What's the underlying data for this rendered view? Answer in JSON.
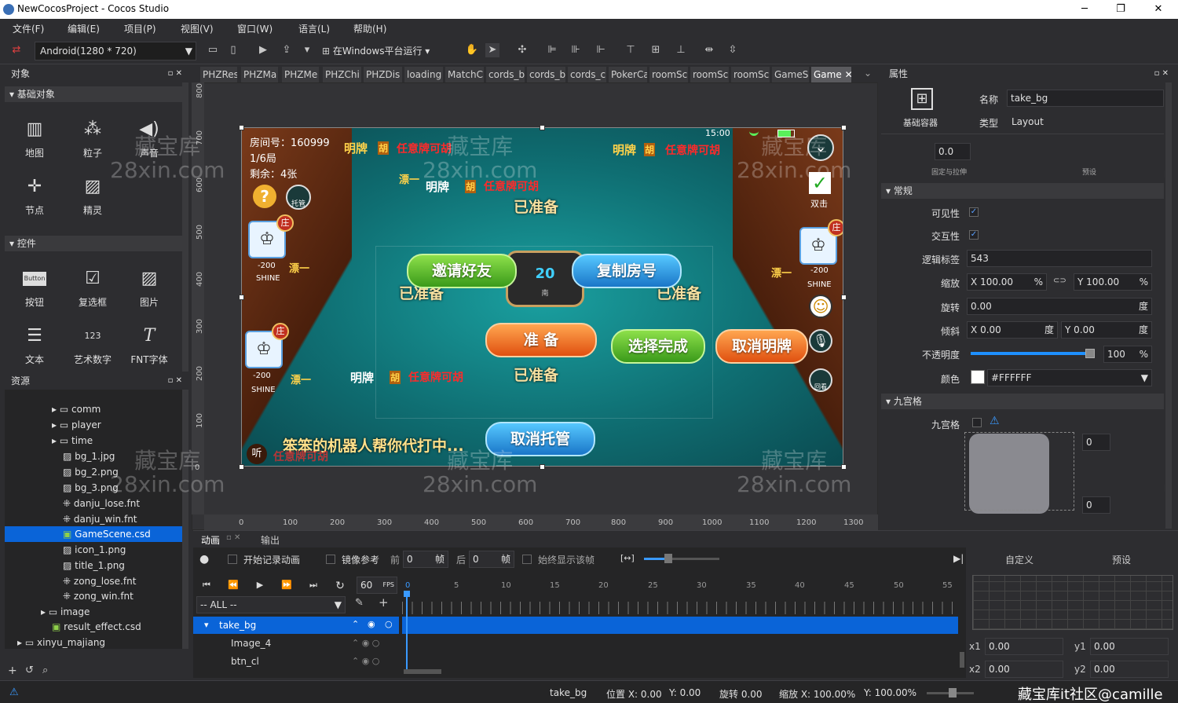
{
  "window": {
    "title": "NewCocosProject - Cocos Studio",
    "min": "─",
    "max": "❐",
    "close": "✕"
  },
  "menu": [
    "文件(F)",
    "编辑(E)",
    "项目(P)",
    "视图(V)",
    "窗口(W)",
    "语言(L)",
    "帮助(H)"
  ],
  "toolbar": {
    "resolution": "Android(1280 * 720)",
    "run_label": "在Windows平台运行"
  },
  "objects_panel": {
    "title": "对象",
    "basic_section": "基础对象",
    "basic_items": [
      "地图",
      "粒子",
      "声音",
      "节点",
      "精灵"
    ],
    "controls_section": "控件",
    "control_items": [
      "按钮",
      "复选框",
      "图片",
      "文本",
      "艺术数字",
      "FNT字体"
    ],
    "button_icon_text": "Button",
    "art_num_icon_text": "123"
  },
  "resources_panel": {
    "title": "资源",
    "items": [
      {
        "label": "comm",
        "type": "folder"
      },
      {
        "label": "player",
        "type": "folder"
      },
      {
        "label": "time",
        "type": "folder"
      },
      {
        "label": "bg_1.jpg",
        "type": "image"
      },
      {
        "label": "bg_2.png",
        "type": "image"
      },
      {
        "label": "bg_3.png",
        "type": "image"
      },
      {
        "label": "danju_lose.fnt",
        "type": "fnt"
      },
      {
        "label": "danju_win.fnt",
        "type": "fnt"
      },
      {
        "label": "GameScene.csd",
        "type": "csd",
        "selected": true
      },
      {
        "label": "icon_1.png",
        "type": "image"
      },
      {
        "label": "title_1.png",
        "type": "image"
      },
      {
        "label": "zong_lose.fnt",
        "type": "fnt"
      },
      {
        "label": "zong_win.fnt",
        "type": "fnt"
      },
      {
        "label": "image",
        "type": "folder"
      },
      {
        "label": "result_effect.csd",
        "type": "csd"
      },
      {
        "label": "xinyu_majiang",
        "type": "folder"
      }
    ]
  },
  "tabs": [
    "PHZRes",
    "PHZMa",
    "PHZMe",
    "PHZChi",
    "PHZDis",
    "loading",
    "MatchC",
    "cords_b",
    "cords_b",
    "cords_c",
    "PokerCa",
    "roomSc",
    "roomSc",
    "roomSc",
    "GameS",
    "Game"
  ],
  "ruler_y": [
    "800",
    "700",
    "600",
    "500",
    "400",
    "300",
    "200",
    "100",
    "0"
  ],
  "ruler_x": [
    "0",
    "100",
    "200",
    "300",
    "400",
    "500",
    "600",
    "700",
    "800",
    "900",
    "1000",
    "1100",
    "1200",
    "1300"
  ],
  "scene": {
    "room_no": "房间号：160999",
    "round": "1/6局",
    "remain": "剩余：4张",
    "time": "15:00",
    "tuoguan": "托管",
    "double": "双击",
    "ming": "明牌",
    "hu": "胡",
    "any_hu": "任意牌可胡",
    "piao": "漂一",
    "ready": "已准备",
    "score": "-200",
    "name": "SHINE",
    "zhuang": "庄",
    "invite": "邀请好友",
    "copy_room": "复制房号",
    "prepare": "准 备",
    "select_done": "选择完成",
    "cancel_ming": "取消明牌",
    "cancel_tuoguan": "取消托管",
    "bot_msg": "笨笨的机器人帮你代打中...",
    "listen": "听",
    "replay": "回看",
    "clock": "20",
    "clock_sub": "南",
    "wm1": "藏宝库",
    "wm2": "28xin.com"
  },
  "properties": {
    "title": "属性",
    "container": "基础容器",
    "name_label": "名称",
    "name_value": "take_bg",
    "type_label": "类型",
    "type_value": "Layout",
    "size_value": "0.0",
    "fixed_stretch": "固定与拉伸",
    "preset": "预设",
    "general": "常规",
    "visible": "可见性",
    "interactive": "交互性",
    "logic_tag": "逻辑标签",
    "logic_tag_value": "543",
    "scale": "缩放",
    "scale_x": "100.00",
    "scale_y": "100.00",
    "percent": "%",
    "rotation": "旋转",
    "rotation_value": "0.00",
    "degree": "度",
    "skew": "倾斜",
    "skew_x": "0.00",
    "skew_y": "0.00",
    "opacity": "不透明度",
    "opacity_value": "100",
    "color": "颜色",
    "color_value": "#FFFFFF",
    "nine": "九宫格",
    "nine_label": "九宫格",
    "nine_value": "0",
    "x": "X",
    "y": "Y"
  },
  "animation": {
    "tab1": "动画",
    "tab2": "输出",
    "record": "开始记录动画",
    "mirror": "镜像参考",
    "before": "前",
    "before_val": "0",
    "frame": "帧",
    "after": "后",
    "after_val": "0",
    "always_show": "始终显示该帧",
    "fps": "60",
    "fps_unit": "FPS",
    "all": "-- ALL --",
    "frames": [
      "0",
      "5",
      "10",
      "15",
      "20",
      "25",
      "30",
      "35",
      "40",
      "45",
      "50",
      "55"
    ],
    "nodes": [
      "take_bg",
      "Image_4",
      "btn_cl"
    ],
    "custom": "自定义",
    "preset": "预设",
    "x1": "x1",
    "x1_val": "0.00",
    "y1": "y1",
    "y1_val": "0.00",
    "x2": "x2",
    "x2_val": "0.00",
    "y2": "y2",
    "y2_val": "0.00"
  },
  "status": {
    "node": "take_bg",
    "pos": "位置 X: 0.00",
    "pos_y": "Y: 0.00",
    "rot": "旋转 0.00",
    "scale": "缩放 X: 100.00%",
    "scale_y": "Y: 100.00%",
    "watermark": "藏宝库it社区@camille"
  },
  "colors": {
    "selection": "#0a64d8",
    "accent": "#5aa0ff"
  }
}
